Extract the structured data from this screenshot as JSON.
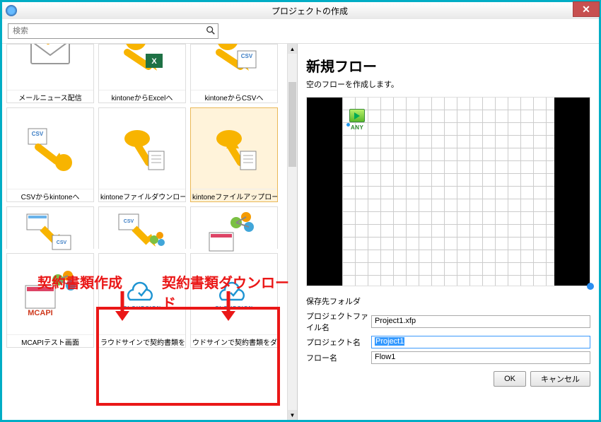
{
  "window": {
    "title": "プロジェクトの作成",
    "close_icon": "✕"
  },
  "search": {
    "placeholder": "検索"
  },
  "tiles": {
    "row1": [
      {
        "label": "メールニュース配信"
      },
      {
        "label": "kintoneからExcelへ"
      },
      {
        "label": "kintoneからCSVへ"
      }
    ],
    "row2": [
      {
        "label": "CSVからkintoneへ"
      },
      {
        "label": "kintoneファイルダウンロード"
      },
      {
        "label": "kintoneファイルアップロード"
      }
    ],
    "row4": [
      {
        "label": "MCAPIテスト画面"
      },
      {
        "label": "ラウドサインで契約書類を作成"
      },
      {
        "label": "ウドサインで契約書類をダウンロ"
      }
    ],
    "cloudsign": "CLOUDSIGN",
    "mcapi": "MCAPI"
  },
  "right_panel": {
    "heading": "新規フロー",
    "description": "空のフローを作成します。",
    "any_label": "ANY"
  },
  "form": {
    "folder_label": "保存先フォルダ",
    "folder_value": "",
    "projfile_label": "プロジェクトファイル名",
    "projfile_value": "Project1.xfp",
    "projname_label": "プロジェクト名",
    "projname_value": "Project1",
    "flowname_label": "フロー名",
    "flowname_value": "Flow1"
  },
  "buttons": {
    "ok": "OK",
    "cancel": "キャンセル"
  },
  "annotations": {
    "left_text": "契約書類作成",
    "right_text": "契約書類ダウンロード"
  }
}
